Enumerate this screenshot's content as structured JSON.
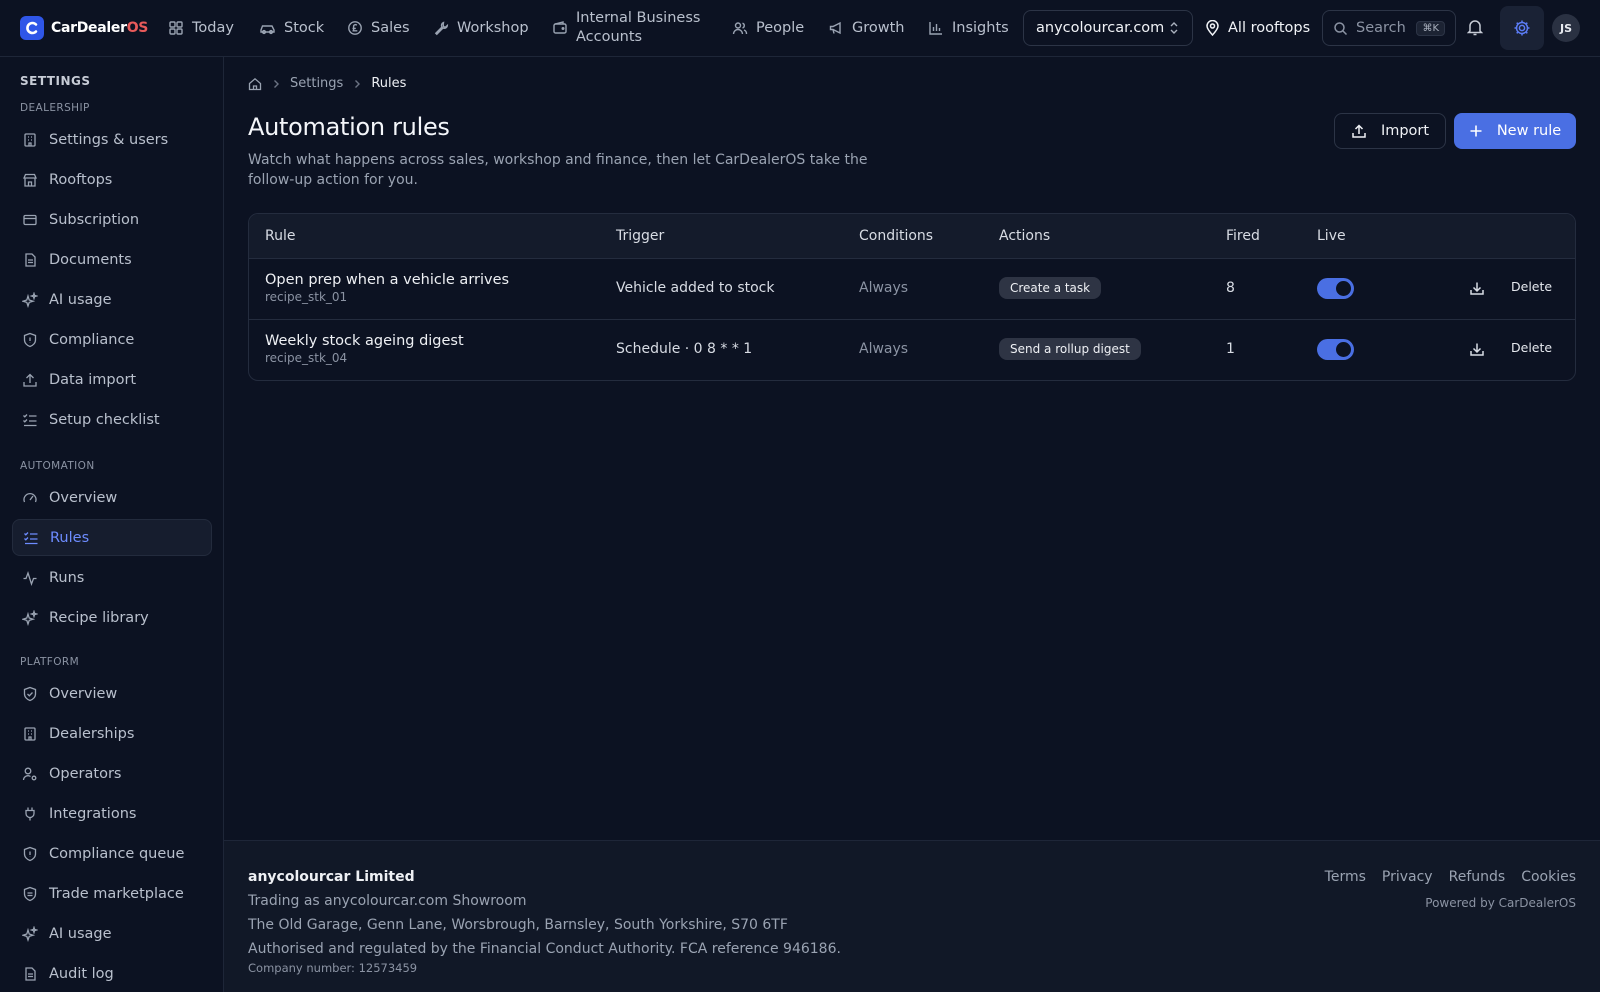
{
  "app": {
    "brand_main": "CarDealer",
    "brand_accent": "OS",
    "accent_color": "#4a6fe3",
    "brand_os_color": "#e85a5a"
  },
  "topnav": {
    "items": [
      {
        "label": "Today",
        "icon": "dashboard-icon"
      },
      {
        "label": "Stock",
        "icon": "car-icon"
      },
      {
        "label": "Sales",
        "icon": "pound-coin-icon"
      },
      {
        "label": "Workshop",
        "icon": "wrench-icon"
      },
      {
        "label": "Internal Business Accounts",
        "icon": "wallet-icon"
      },
      {
        "label": "People",
        "icon": "users-icon"
      },
      {
        "label": "Growth",
        "icon": "megaphone-icon"
      },
      {
        "label": "Insights",
        "icon": "bar-chart-icon"
      }
    ],
    "site_select": "anycolourcar.com",
    "rooftops": "All rooftops",
    "search_placeholder": "Search",
    "search_shortcut": "⌘K",
    "avatar_initials": "JS"
  },
  "sidebar": {
    "title": "SETTINGS",
    "groups": [
      {
        "label": "DEALERSHIP",
        "items": [
          {
            "label": "Settings & users",
            "icon": "building-icon"
          },
          {
            "label": "Rooftops",
            "icon": "store-icon"
          },
          {
            "label": "Subscription",
            "icon": "credit-card-icon"
          },
          {
            "label": "Documents",
            "icon": "document-icon"
          },
          {
            "label": "AI usage",
            "icon": "sparkles-icon"
          },
          {
            "label": "Compliance",
            "icon": "shield-icon"
          },
          {
            "label": "Data import",
            "icon": "upload-icon"
          },
          {
            "label": "Setup checklist",
            "icon": "checklist-icon"
          }
        ]
      },
      {
        "label": "AUTOMATION",
        "items": [
          {
            "label": "Overview",
            "icon": "gauge-icon"
          },
          {
            "label": "Rules",
            "icon": "checklist-icon",
            "active": true
          },
          {
            "label": "Runs",
            "icon": "activity-icon"
          },
          {
            "label": "Recipe library",
            "icon": "sparkles-icon"
          }
        ]
      },
      {
        "label": "PLATFORM",
        "items": [
          {
            "label": "Overview",
            "icon": "shield-check-icon"
          },
          {
            "label": "Dealerships",
            "icon": "building-icon"
          },
          {
            "label": "Operators",
            "icon": "user-cog-icon"
          },
          {
            "label": "Integrations",
            "icon": "plug-icon"
          },
          {
            "label": "Compliance queue",
            "icon": "shield-icon"
          },
          {
            "label": "Trade marketplace",
            "icon": "shield-tag-icon"
          },
          {
            "label": "AI usage",
            "icon": "sparkles-icon"
          },
          {
            "label": "Audit log",
            "icon": "document-icon"
          }
        ]
      }
    ]
  },
  "breadcrumb": {
    "items": [
      "Settings",
      "Rules"
    ]
  },
  "page": {
    "title": "Automation rules",
    "description": "Watch what happens across sales, workshop and finance, then let CarDealerOS take the follow-up action for you.",
    "import_label": "Import",
    "new_rule_label": "New rule"
  },
  "table": {
    "headers": [
      "Rule",
      "Trigger",
      "Conditions",
      "Actions",
      "Fired",
      "Live"
    ],
    "rows": [
      {
        "name": "Open prep when a vehicle arrives",
        "id": "recipe_stk_01",
        "trigger": "Vehicle added to stock",
        "conditions": "Always",
        "action": "Create a task",
        "fired": "8",
        "live": true,
        "delete_label": "Delete"
      },
      {
        "name": "Weekly stock ageing digest",
        "id": "recipe_stk_04",
        "trigger": "Schedule · 0 8 * * 1",
        "conditions": "Always",
        "action": "Send a rollup digest",
        "fired": "1",
        "live": true,
        "delete_label": "Delete"
      }
    ]
  },
  "footer": {
    "company": "anycolourcar Limited",
    "trading_as": "Trading as anycolourcar.com Showroom",
    "address": "The Old Garage, Genn Lane, Worsbrough, Barnsley, South Yorkshire, S70 6TF",
    "regulation": "Authorised and regulated by the Financial Conduct Authority. FCA reference 946186.",
    "company_number": "Company number: 12573459",
    "links": [
      "Terms",
      "Privacy",
      "Refunds",
      "Cookies"
    ],
    "powered_by": "Powered by CarDealerOS"
  }
}
